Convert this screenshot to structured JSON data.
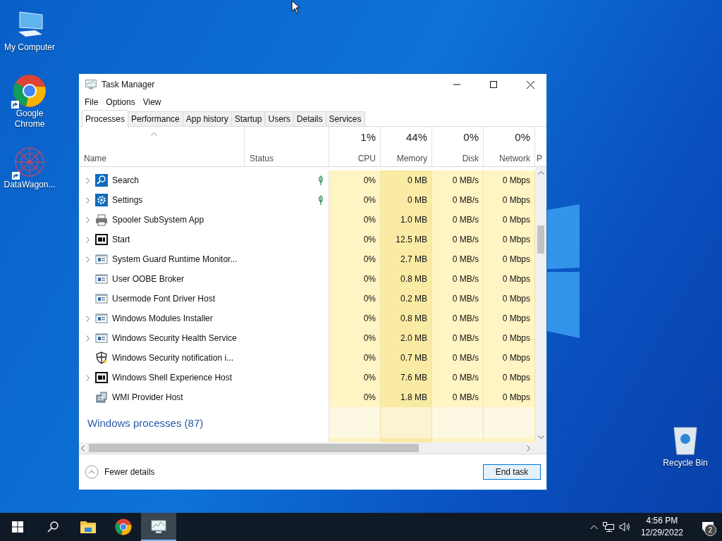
{
  "desktop_icons": [
    {
      "label": "My Computer",
      "kind": "computer",
      "shortcut": false
    },
    {
      "label": "Google Chrome",
      "kind": "chrome",
      "shortcut": true
    },
    {
      "label": "DataWagon...",
      "kind": "wagon",
      "shortcut": true
    },
    {
      "label": "Recycle Bin",
      "kind": "bin",
      "shortcut": false
    }
  ],
  "window": {
    "title": "Task Manager",
    "menu": [
      "File",
      "Options",
      "View"
    ],
    "tabs": [
      {
        "label": "Processes",
        "selected": true
      },
      {
        "label": "Performance",
        "selected": false
      },
      {
        "label": "App history",
        "selected": false
      },
      {
        "label": "Startup",
        "selected": false
      },
      {
        "label": "Users",
        "selected": false
      },
      {
        "label": "Details",
        "selected": false
      },
      {
        "label": "Services",
        "selected": false
      }
    ],
    "columns": [
      {
        "label": "Name",
        "sorted": true
      },
      {
        "label": "Status",
        "sorted": false
      },
      {
        "label": "CPU",
        "total": "1%"
      },
      {
        "label": "Memory",
        "total": "44%"
      },
      {
        "label": "Disk",
        "total": "0%"
      },
      {
        "label": "Network",
        "total": "0%"
      },
      {
        "label": "P"
      }
    ],
    "rows": [
      {
        "name": "Search",
        "kind": "search",
        "expandable": true,
        "eco": true,
        "cpu": "0%",
        "memory": "0 MB",
        "disk": "0 MB/s",
        "network": "0 Mbps"
      },
      {
        "name": "Settings",
        "kind": "gear",
        "expandable": true,
        "eco": true,
        "cpu": "0%",
        "memory": "0 MB",
        "disk": "0 MB/s",
        "network": "0 Mbps"
      },
      {
        "name": "Spooler SubSystem App",
        "kind": "printer",
        "expandable": true,
        "eco": false,
        "cpu": "0%",
        "memory": "1.0 MB",
        "disk": "0 MB/s",
        "network": "0 Mbps"
      },
      {
        "name": "Start",
        "kind": "frame",
        "expandable": true,
        "eco": false,
        "cpu": "0%",
        "memory": "12.5 MB",
        "disk": "0 MB/s",
        "network": "0 Mbps"
      },
      {
        "name": "System Guard Runtime Monitor...",
        "kind": "app",
        "expandable": true,
        "eco": false,
        "cpu": "0%",
        "memory": "2.7 MB",
        "disk": "0 MB/s",
        "network": "0 Mbps"
      },
      {
        "name": "User OOBE Broker",
        "kind": "app",
        "expandable": false,
        "eco": false,
        "cpu": "0%",
        "memory": "0.8 MB",
        "disk": "0 MB/s",
        "network": "0 Mbps"
      },
      {
        "name": "Usermode Font Driver Host",
        "kind": "app",
        "expandable": false,
        "eco": false,
        "cpu": "0%",
        "memory": "0.2 MB",
        "disk": "0 MB/s",
        "network": "0 Mbps"
      },
      {
        "name": "Windows Modules Installer",
        "kind": "app",
        "expandable": true,
        "eco": false,
        "cpu": "0%",
        "memory": "0.8 MB",
        "disk": "0 MB/s",
        "network": "0 Mbps"
      },
      {
        "name": "Windows Security Health Service",
        "kind": "app",
        "expandable": true,
        "eco": false,
        "cpu": "0%",
        "memory": "2.0 MB",
        "disk": "0 MB/s",
        "network": "0 Mbps"
      },
      {
        "name": "Windows Security notification i...",
        "kind": "shield",
        "expandable": false,
        "eco": false,
        "cpu": "0%",
        "memory": "0.7 MB",
        "disk": "0 MB/s",
        "network": "0 Mbps"
      },
      {
        "name": "Windows Shell Experience Host",
        "kind": "frame",
        "expandable": true,
        "eco": false,
        "cpu": "0%",
        "memory": "7.6 MB",
        "disk": "0 MB/s",
        "network": "0 Mbps"
      },
      {
        "name": "WMI Provider Host",
        "kind": "wmi",
        "expandable": false,
        "eco": false,
        "cpu": "0%",
        "memory": "1.8 MB",
        "disk": "0 MB/s",
        "network": "0 Mbps"
      }
    ],
    "group": "Windows processes (87)",
    "details_toggle": "Fewer details",
    "end_task": "End task"
  },
  "taskbar": {
    "apps": [
      {
        "kind": "start",
        "selected": false
      },
      {
        "kind": "search",
        "selected": false
      },
      {
        "kind": "folder",
        "selected": false
      },
      {
        "kind": "chrome",
        "selected": false
      },
      {
        "kind": "taskmgr",
        "selected": true
      }
    ],
    "time": "4:56 PM",
    "date": "12/29/2022",
    "notifications": "2"
  }
}
